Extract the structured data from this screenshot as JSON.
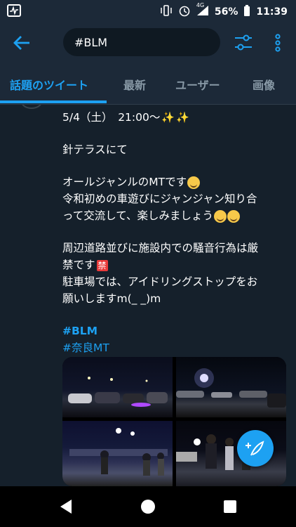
{
  "status": {
    "battery": "56%",
    "time": "11:39",
    "network": "4G"
  },
  "search": {
    "query": "#BLM"
  },
  "tabs": [
    {
      "label": "話題のツイート"
    },
    {
      "label": "最新"
    },
    {
      "label": "ユーザー"
    },
    {
      "label": "画像"
    }
  ],
  "tweet": {
    "lines": [
      "5/4（土）　21:00〜",
      "針テラスにて",
      "オールジャンルのMTです",
      "令和初めの車遊びにジャンジャン知り合",
      "って交流して、楽しみましょう",
      "周辺道路並びに施設内での騒音行為は厳",
      "禁です",
      "駐車場では、アイドリングストップをお",
      "願いしますm(_ _)m"
    ],
    "ban_mark": "禁",
    "hashtags": [
      "#BLM",
      "#奈良MT"
    ]
  },
  "icons": {
    "back": "arrow-left-icon",
    "filter": "filter-sliders-icon",
    "more": "more-vertical-icon",
    "compose": "compose-feather-icon",
    "nav_back": "triangle-back-icon",
    "nav_home": "circle-home-icon",
    "nav_recent": "square-recents-icon"
  },
  "colors": {
    "accent": "#1da1f2",
    "background": "#15202b",
    "bar": "#1c2938"
  }
}
